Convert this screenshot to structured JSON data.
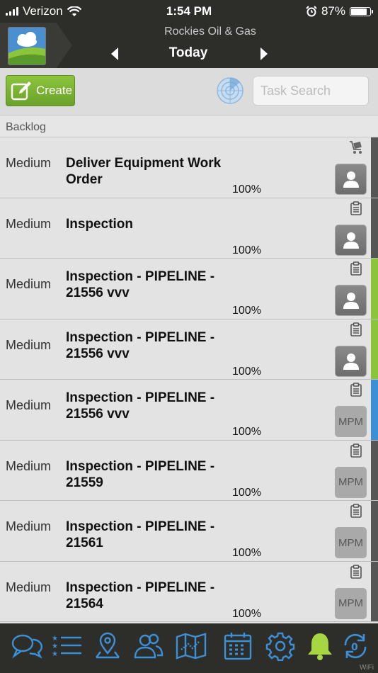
{
  "status_bar": {
    "carrier": "Verizon",
    "time": "1:54 PM",
    "battery": "87%",
    "battery_level": 0.87,
    "icons": [
      "signal-icon",
      "wifi-icon",
      "alarm-icon",
      "battery-icon"
    ]
  },
  "header": {
    "company": "Rockies Oil & Gas",
    "title": "Today",
    "prev_icon": "chevron-left-icon",
    "next_icon": "chevron-right-icon"
  },
  "toolbar": {
    "create_label": "Create",
    "search_placeholder": "Task Search",
    "radar_icon": "radar-icon"
  },
  "section": {
    "label": "Backlog"
  },
  "tasks": [
    {
      "priority": "Medium",
      "title": "Deliver Equipment Work Order",
      "progress": "100%",
      "type_icon": "cart-icon",
      "assignee": "person",
      "stripe": "#555555"
    },
    {
      "priority": "Medium",
      "title": "Inspection",
      "progress": "100%",
      "type_icon": "clipboard-icon",
      "assignee": "person",
      "stripe": "#555555"
    },
    {
      "priority": "Medium",
      "title": "Inspection - PIPELINE - 21556 vvv",
      "progress": "100%",
      "type_icon": "clipboard-icon",
      "assignee": "person",
      "stripe": "#8cc43c"
    },
    {
      "priority": "Medium",
      "title": "Inspection - PIPELINE - 21556 vvv",
      "progress": "100%",
      "type_icon": "clipboard-icon",
      "assignee": "person",
      "stripe": "#8cc43c"
    },
    {
      "priority": "Medium",
      "title": "Inspection - PIPELINE - 21556 vvv",
      "progress": "100%",
      "type_icon": "clipboard-icon",
      "assignee": "MPM",
      "stripe": "#3d8fd6"
    },
    {
      "priority": "Medium",
      "title": "Inspection - PIPELINE - 21559",
      "progress": "100%",
      "type_icon": "clipboard-icon",
      "assignee": "MPM",
      "stripe": "#555555"
    },
    {
      "priority": "Medium",
      "title": "Inspection - PIPELINE - 21561",
      "progress": "100%",
      "type_icon": "clipboard-icon",
      "assignee": "MPM",
      "stripe": "#555555"
    },
    {
      "priority": "Medium",
      "title": "Inspection - PIPELINE - 21564",
      "progress": "100%",
      "type_icon": "clipboard-icon",
      "assignee": "MPM",
      "stripe": "#555555"
    }
  ],
  "tab_bar": {
    "items": [
      "chat-icon",
      "list-icon",
      "map-pin-icon",
      "users-icon",
      "map-icon",
      "calendar-icon",
      "gear-icon",
      "bell-icon",
      "sync-icon"
    ],
    "active": "bell-icon",
    "accent": "#3d8fd6",
    "active_color": "#a6d642",
    "connection": "WiFi"
  },
  "colors": {
    "brand_green": "#8cc43c",
    "header_bg": "#2d2e2a"
  }
}
